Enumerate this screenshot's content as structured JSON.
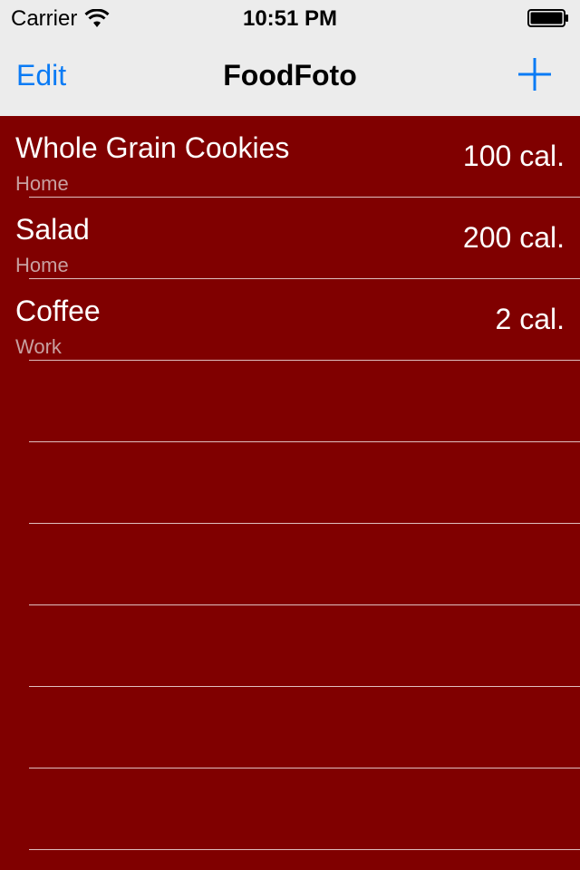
{
  "status_bar": {
    "carrier": "Carrier",
    "time": "10:51 PM",
    "wifi_icon": "wifi-icon",
    "battery_icon": "battery-icon"
  },
  "nav": {
    "edit_label": "Edit",
    "title": "FoodFoto",
    "add_icon": "plus-icon"
  },
  "colors": {
    "accent": "#0a7bf5",
    "list_background": "#800000",
    "nav_background": "#ececec"
  },
  "items": [
    {
      "name": "Whole Grain Cookies",
      "location": "Home",
      "calories": "100 cal."
    },
    {
      "name": "Salad",
      "location": "Home",
      "calories": "200 cal."
    },
    {
      "name": "Coffee",
      "location": "Work",
      "calories": "2 cal."
    }
  ]
}
